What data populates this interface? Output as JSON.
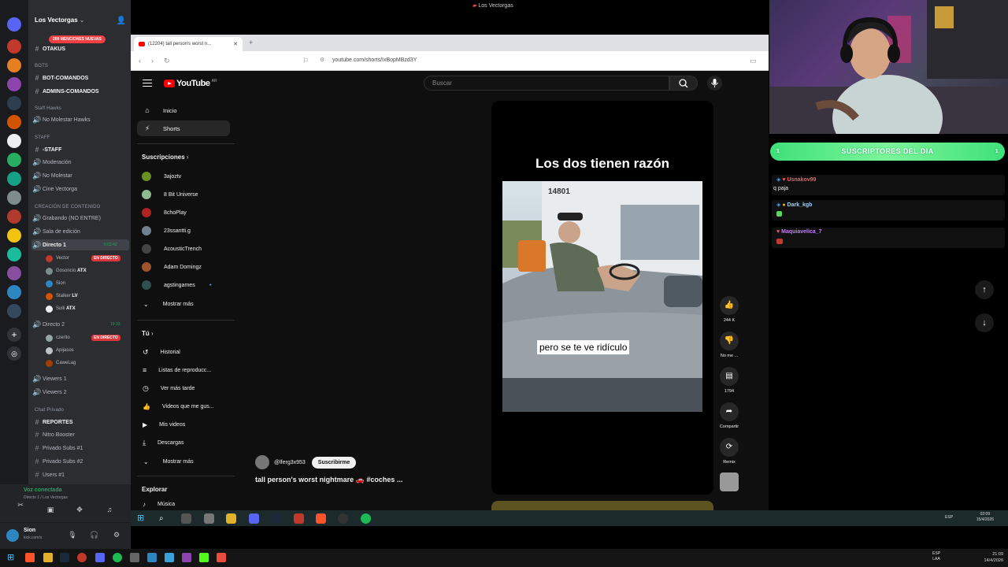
{
  "stream_title": "Los Vectorgas",
  "discord": {
    "server_name": "Los Vectorgas",
    "mentions": "209 MENCIONES NUEVAS",
    "channels_top": [
      "OTAKUS"
    ],
    "cat_bots": "BOTS",
    "bot_channels": [
      "BOT-COMANDOS",
      "ADMINS-COMANDOS"
    ],
    "cat_staff_hawks": "Staff Hawks",
    "staff_hawks_channels": [
      "No Molestar Hawks"
    ],
    "cat_staff": "STAFF",
    "staff_channels": [
      "-STAFF",
      "Moderación",
      "No Molestar",
      "Cine Vectorga"
    ],
    "cat_content": "CREACIÓN DE CONTENIDO",
    "content_channels": [
      "Grabando (NO ENTRE)",
      "Sala de edición"
    ],
    "directo1": {
      "name": "Directo 1",
      "time": "6:02:42"
    },
    "directo1_users": [
      {
        "name": "Vector",
        "live": "EN DIRECTO"
      },
      {
        "name": "Gosoncio",
        "tag": "ATX"
      },
      {
        "name": "Sion",
        "tag": ""
      },
      {
        "name": "Stalker",
        "tag": "LV"
      },
      {
        "name": "Sulli",
        "tag": "ATX"
      }
    ],
    "directo2": {
      "name": "Directo 2",
      "time": "19:33"
    },
    "directo2_users": [
      {
        "name": "czerito",
        "live": "EN DIRECTO"
      },
      {
        "name": "Apijasos",
        "tag": ""
      },
      {
        "name": "CaweLag",
        "tag": ""
      }
    ],
    "viewer_channels": [
      "Viewers 1",
      "Viewers 2"
    ],
    "cat_private": "Chat Privado",
    "private_channels": [
      "REPORTES",
      "Nitro Booster",
      "Privado Subs #1",
      "Privado Subs #2",
      "Users #1"
    ],
    "voice_status": "Voz conectada",
    "voice_sub": "Directo 1 / Los Vectorgas",
    "user_name": "Sion",
    "user_status": "kick.com/s"
  },
  "browser": {
    "tab_title": "(12204) tall person's worst n...",
    "url": "youtube.com/shorts/IxBopMBzd3Y"
  },
  "youtube": {
    "logo": "YouTube",
    "country": "AR",
    "search_placeholder": "Buscar",
    "nav": [
      {
        "label": "Inicio",
        "icon": "⌂"
      },
      {
        "label": "Shorts",
        "icon": "⚡"
      }
    ],
    "subs_title": "Suscripciones",
    "subscriptions": [
      "3ajoztv",
      "8 Bit Universe",
      "8choPlay",
      "23ssantti.g",
      "AcousticTrench",
      "Adam Domingz",
      "agstingames"
    ],
    "show_more": "Mostrar más",
    "you_title": "Tú",
    "you_items": [
      {
        "label": "Historial",
        "icon": "↺"
      },
      {
        "label": "Listas de reproducc...",
        "icon": "≡"
      },
      {
        "label": "Ver más tarde",
        "icon": "◷"
      },
      {
        "label": "Videos que me gus...",
        "icon": "👍"
      },
      {
        "label": "Mis videos",
        "icon": "▶"
      },
      {
        "label": "Descargas",
        "icon": "⤓"
      }
    ],
    "show_more_2": "Mostrar más",
    "explore_title": "Explorar",
    "explore_first": "Música",
    "short": {
      "title": "Los dos tienen razón",
      "caption": "pero se te ve ridículo",
      "plate": "14801",
      "likes": "244 K",
      "dislike_label": "No me ...",
      "comments": "1794",
      "share_label": "Compartir",
      "remix_label": "Remix",
      "channel": "@lferg3x953",
      "subscribe": "Suscribirme",
      "description": "tall person's worst nightmare 🚗 #coches ..."
    }
  },
  "chat": {
    "banner": "SUSCRIPTORES DEL DIA",
    "banner_count_left": "1",
    "banner_count_right": "1",
    "lines": [
      {
        "user": "Usnakov99",
        "msg": "q paja",
        "color": "#ff5b5b"
      },
      {
        "user": "Dark_kgb",
        "msg": "",
        "color": "#9ad1ff"
      },
      {
        "user": "Maquiavelica_7",
        "msg": "",
        "color": "#c77dff"
      }
    ]
  },
  "taskbar": {
    "lang": "ESP",
    "time": "02:09",
    "date": "15/4/2026"
  },
  "os_taskbar": {
    "lang_top": "ESP",
    "lang_bottom": "LAA",
    "time": "21:09",
    "date": "14/4/2026"
  }
}
